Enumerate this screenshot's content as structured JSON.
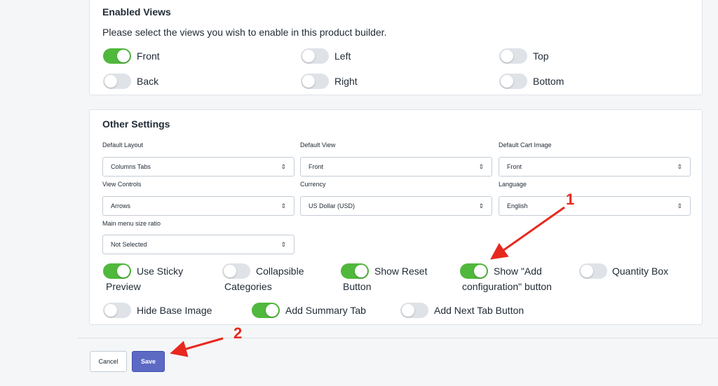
{
  "enabled_views": {
    "title": "Enabled Views",
    "description": "Please select the views you wish to enable in this product builder.",
    "views": [
      {
        "label": "Front",
        "on": true
      },
      {
        "label": "Left",
        "on": false
      },
      {
        "label": "Top",
        "on": false
      },
      {
        "label": "Back",
        "on": false
      },
      {
        "label": "Right",
        "on": false
      },
      {
        "label": "Bottom",
        "on": false
      }
    ]
  },
  "other_settings": {
    "title": "Other Settings",
    "fields": {
      "default_layout": {
        "label": "Default Layout",
        "value": "Columns Tabs"
      },
      "default_view": {
        "label": "Default View",
        "value": "Front"
      },
      "default_cart_image": {
        "label": "Default Cart Image",
        "value": "Front"
      },
      "view_controls": {
        "label": "View Controls",
        "value": "Arrows"
      },
      "currency": {
        "label": "Currency",
        "value": "US Dollar (USD)"
      },
      "language": {
        "label": "Language",
        "value": "English"
      },
      "main_menu_size_ratio": {
        "label": "Main menu size ratio",
        "value": "Not Selected"
      }
    },
    "toggles": [
      {
        "label": "Use Sticky Preview",
        "line1": "Use Sticky",
        "line2": "Preview",
        "on": true
      },
      {
        "label": "Collapsible Categories",
        "line1": "Collapsible",
        "line2": "Categories",
        "on": false
      },
      {
        "label": "Show Reset Button",
        "line1": "Show Reset",
        "line2": "Button",
        "on": true
      },
      {
        "label": "Show \"Add configuration\" button",
        "line1": "Show \"Add",
        "line2": "configuration\" button",
        "on": true
      },
      {
        "label": "Quantity Box",
        "line1": "Quantity Box",
        "line2": "",
        "on": false
      },
      {
        "label": "Hide Base Image",
        "line1": "Hide Base Image",
        "line2": "",
        "on": false
      },
      {
        "label": "Add Summary Tab",
        "line1": "Add Summary Tab",
        "line2": "",
        "on": true
      },
      {
        "label": "Add Next Tab Button",
        "line1": "Add Next Tab Button",
        "line2": "",
        "on": false
      }
    ]
  },
  "footer": {
    "cancel_label": "Cancel",
    "save_label": "Save"
  },
  "annotations": {
    "marker_1": "1",
    "marker_2": "2",
    "color": "#e8281e"
  },
  "colors": {
    "toggle_on": "#50b83c",
    "toggle_off": "#dfe3e8",
    "save_button": "#5c6ac4"
  }
}
